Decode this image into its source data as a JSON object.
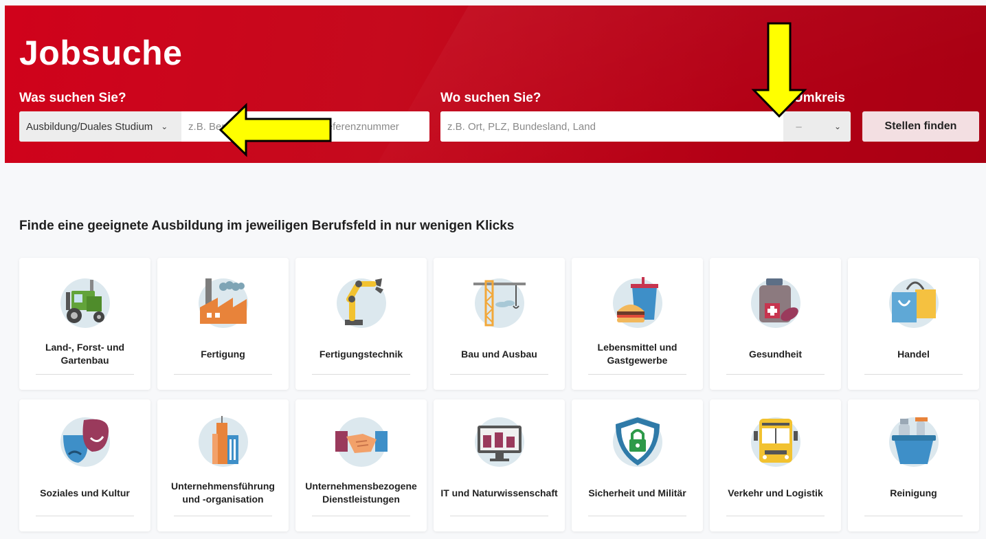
{
  "header": {
    "title": "Jobsuche",
    "what_label": "Was suchen Sie?",
    "where_label": "Wo suchen Sie?",
    "radius_label": "Umkreis",
    "category_select_value": "Ausbildung/Duales Studium",
    "what_placeholder": "z.B. Beruf, Firma, Stichwort, Referenznummer",
    "where_placeholder": "z.B. Ort, PLZ, Bundesland, Land",
    "radius_value": "–",
    "find_button": "Stellen finden"
  },
  "section": {
    "heading": "Finde eine geeignete Ausbildung im jeweiligen Berufsfeld in nur wenigen Klicks"
  },
  "categories": [
    {
      "label": "Land-, Forst- und Gartenbau",
      "icon": "tractor-icon"
    },
    {
      "label": "Fertigung",
      "icon": "factory-icon"
    },
    {
      "label": "Fertigungstechnik",
      "icon": "robot-arm-icon"
    },
    {
      "label": "Bau und Ausbau",
      "icon": "crane-icon"
    },
    {
      "label": "Lebensmittel und Gastgewerbe",
      "icon": "burger-drink-icon"
    },
    {
      "label": "Gesundheit",
      "icon": "medicine-icon"
    },
    {
      "label": "Handel",
      "icon": "shopping-bag-icon"
    },
    {
      "label": "Soziales und Kultur",
      "icon": "theater-masks-icon"
    },
    {
      "label": "Unternehmensführung und -organisation",
      "icon": "office-building-icon"
    },
    {
      "label": "Unternehmensbezogene Dienstleistungen",
      "icon": "handshake-icon"
    },
    {
      "label": "IT und Naturwissenschaft",
      "icon": "monitor-chart-icon"
    },
    {
      "label": "Sicherheit und Militär",
      "icon": "shield-lock-icon"
    },
    {
      "label": "Verkehr und Logistik",
      "icon": "bus-icon"
    },
    {
      "label": "Reinigung",
      "icon": "cleaning-bucket-icon"
    }
  ],
  "colors": {
    "brand_red": "#d0021b",
    "annotation_arrow": "#ffff00",
    "button_bg": "#f3dfe2"
  }
}
